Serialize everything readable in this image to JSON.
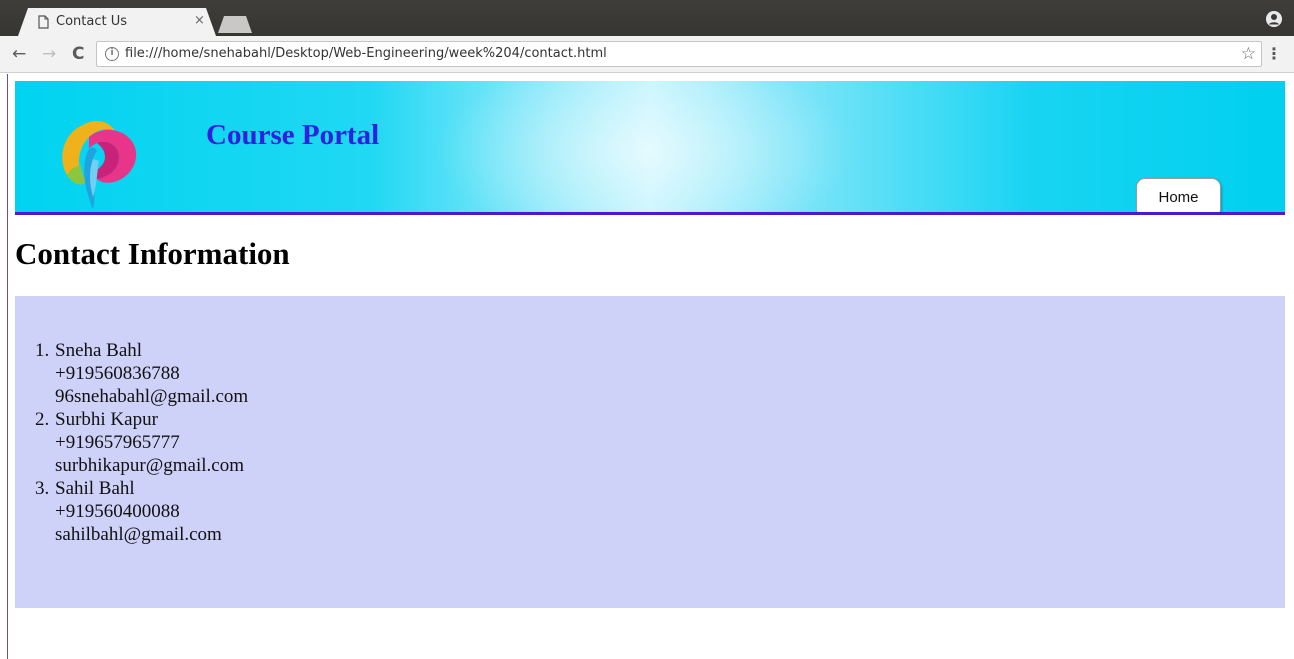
{
  "browser": {
    "tab_title": "Contact Us",
    "tab_close": "×",
    "url": "file:///home/snehabahl/Desktop/Web-Engineering/week%204/contact.html",
    "icons": {
      "back": "arrow-left-icon",
      "forward": "arrow-right-icon",
      "reload": "reload-icon",
      "info": "info-icon",
      "bookmark": "star-icon",
      "menu": "kebab-menu-icon",
      "profile": "profile-icon"
    }
  },
  "header": {
    "title": "Course Portal",
    "nav": {
      "home_label": "Home"
    },
    "colors": {
      "title": "#3021e0",
      "border": "#4a18d6",
      "background": "#00d3f0"
    }
  },
  "main": {
    "heading": "Contact Information",
    "box_color": "#ced2f8",
    "contacts": [
      {
        "number": "1.",
        "name": "Sneha Bahl",
        "phone": "+919560836788",
        "email": "96snehabahl@gmail.com"
      },
      {
        "number": "2.",
        "name": "Surbhi Kapur",
        "phone": "+919657965777",
        "email": "surbhikapur@gmail.com"
      },
      {
        "number": "3.",
        "name": "Sahil Bahl",
        "phone": "+919560400088",
        "email": "sahilbahl@gmail.com"
      }
    ]
  }
}
